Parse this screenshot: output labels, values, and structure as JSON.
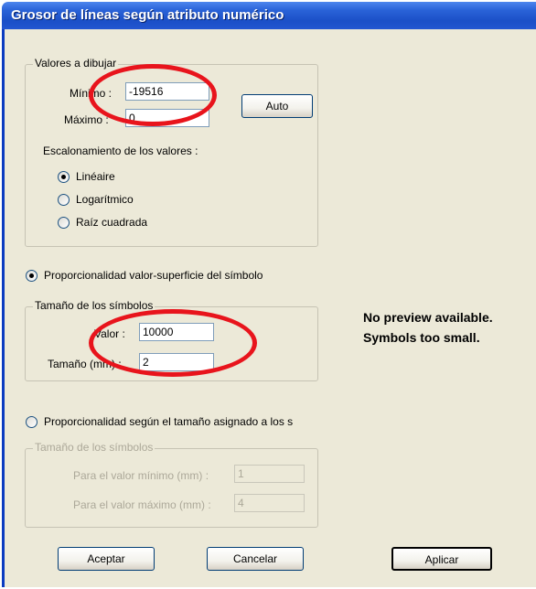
{
  "window": {
    "title": "Grosor de líneas según atributo numérico"
  },
  "values_group": {
    "legend": "Valores a dibujar",
    "min_label": "Mínimo :",
    "min_value": "-19516",
    "max_label": "Máximo :",
    "max_value": "0",
    "auto_button": "Auto"
  },
  "scaling": {
    "label": "Escalonamiento de los valores :",
    "options": [
      "Linéaire",
      "Logarítmico",
      "Raíz cuadrada"
    ],
    "selected": "Linéaire"
  },
  "mode_area": {
    "label": "Proporcionalidad valor-superficie del símbolo",
    "selected": true
  },
  "symbol_size_group": {
    "legend": "Tamaño de los símbolos",
    "value_label": "Valor :",
    "value": "10000",
    "size_label": "Tamaño (mm) :",
    "size": "2"
  },
  "preview": {
    "line1": "No preview available.",
    "line2": "Symbols too small."
  },
  "mode_assigned": {
    "label": "Proporcionalidad según el tamaño asignado a los s",
    "selected": false
  },
  "assigned_group": {
    "legend": "Tamaño de los símbolos",
    "min_label": "Para el valor mínimo (mm) :",
    "min_value": "1",
    "max_label": "Para el valor máximo (mm) :",
    "max_value": "4"
  },
  "buttons": {
    "accept": "Aceptar",
    "cancel": "Cancelar",
    "apply": "Aplicar"
  },
  "colors": {
    "title_bar": "#2a63d8",
    "dialog_bg": "#ece9d8",
    "highlight_ellipse": "#e8141c"
  }
}
